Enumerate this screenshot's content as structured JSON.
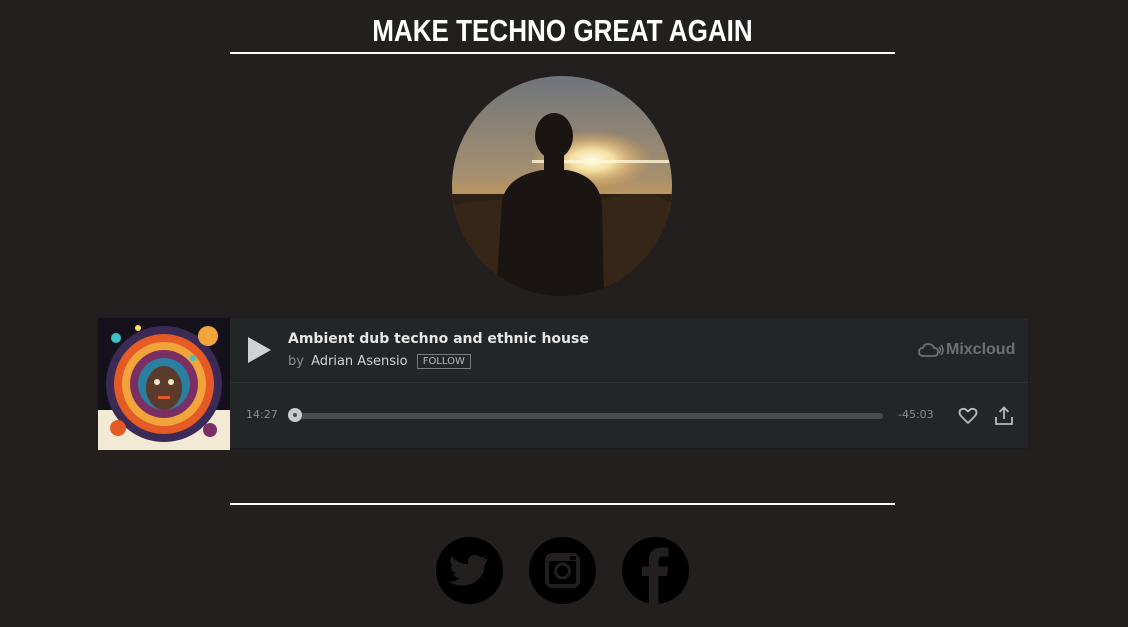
{
  "header": {
    "title": "MAKE TECHNO GREAT AGAIN"
  },
  "player": {
    "track_title": "Ambient dub techno and ethnic house",
    "by_label": "by",
    "artist": "Adrian Asensio",
    "follow_label": "FOLLOW",
    "brand": "Mixcloud",
    "time_elapsed": "14:27",
    "time_remaining": "-45:03",
    "progress_fraction": 0.0
  },
  "social": [
    {
      "icon": "twitter-icon"
    },
    {
      "icon": "instagram-icon"
    },
    {
      "icon": "facebook-icon"
    }
  ],
  "colors": {
    "background": "#231f1e",
    "player_bg": "#232628",
    "text_light": "#e6e6e6",
    "text_muted": "#8a8d90",
    "rule": "#ffffff"
  }
}
